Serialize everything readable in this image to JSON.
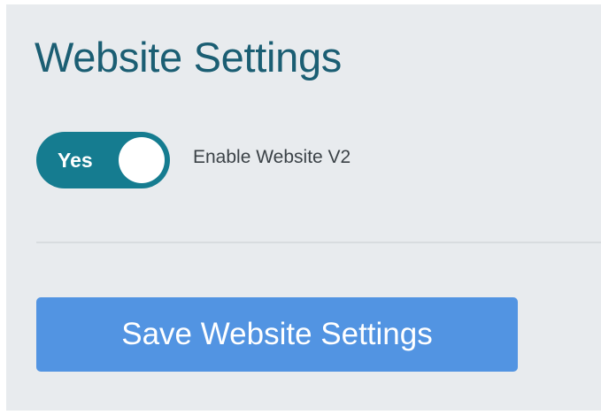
{
  "page": {
    "title": "Website Settings"
  },
  "toggle": {
    "state_label": "Yes",
    "is_on": true,
    "label": "Enable Website V2",
    "color": "#157c90"
  },
  "save_button": {
    "label": "Save Website Settings",
    "color": "#5294e2"
  },
  "colors": {
    "panel_background": "#e8ebee",
    "title_text": "#1b5e73"
  }
}
